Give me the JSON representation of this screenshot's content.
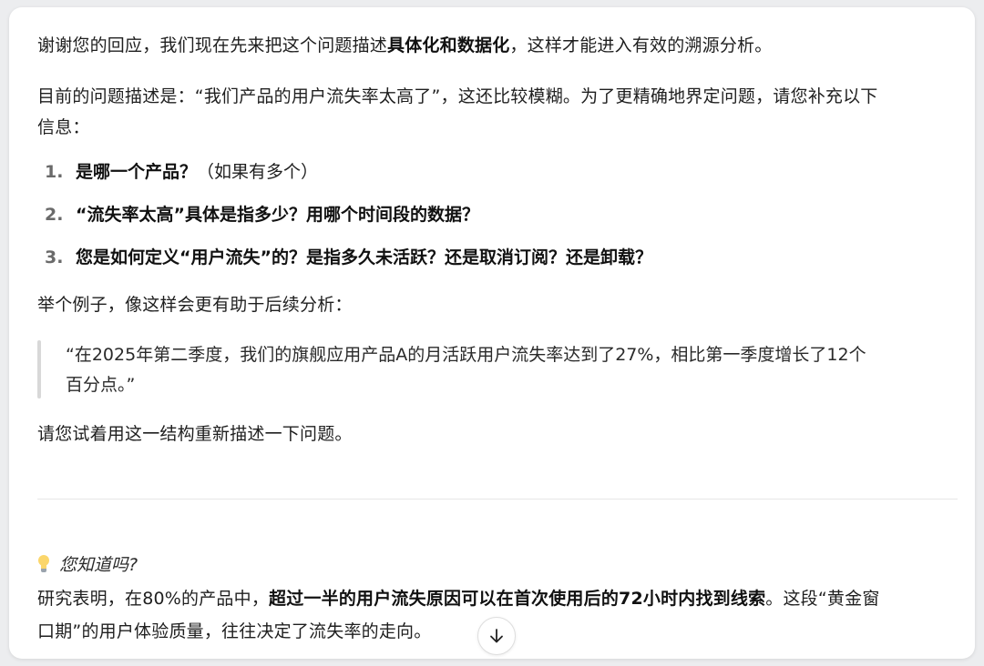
{
  "message": {
    "p1": {
      "pre": "谢谢您的回应，我们现在先来把这个问题描述",
      "bold": "具体化和数据化",
      "post": "，这样才能进入有效的溯源分析。"
    },
    "p2": {
      "line1": "目前的问题描述是：“我们产品的用户流失率太高了”，这还比较模糊。为了更精确地界定问题，请您补充以下",
      "line2": "信息："
    },
    "list": [
      {
        "num": "1.",
        "bold": "是哪一个产品？",
        "rest": "（如果有多个）"
      },
      {
        "num": "2.",
        "bold": "“流失率太高”具体是指多少？用哪个时间段的数据？",
        "rest": ""
      },
      {
        "num": "3.",
        "bold": "您是如何定义“用户流失”的？是指多久未活跃？还是取消订阅？还是卸载？",
        "rest": ""
      }
    ],
    "example_intro": "举个例子，像这样会更有助于后续分析：",
    "quote": {
      "line1": "“在2025年第二季度，我们的旗舰应用产品A的月活跃用户流失率达到了27%，相比第一季度增长了12个",
      "line2": "百分点。”"
    },
    "closing": "请您试着用这一结构重新描述一下问题。"
  },
  "tip": {
    "icon": "lightbulb-icon",
    "heading": "您知道吗?",
    "line1_pre": "研究表明，在80%的产品中，",
    "line1_bold": "超过一半的用户流失原因可以在首次使用后的72小时内找到线索",
    "line1_post": "。这段“黄金窗",
    "line2": "口期”的用户体验质量，往往决定了流失率的走向。"
  },
  "scroll_button": {
    "icon": "arrow-down-icon"
  }
}
